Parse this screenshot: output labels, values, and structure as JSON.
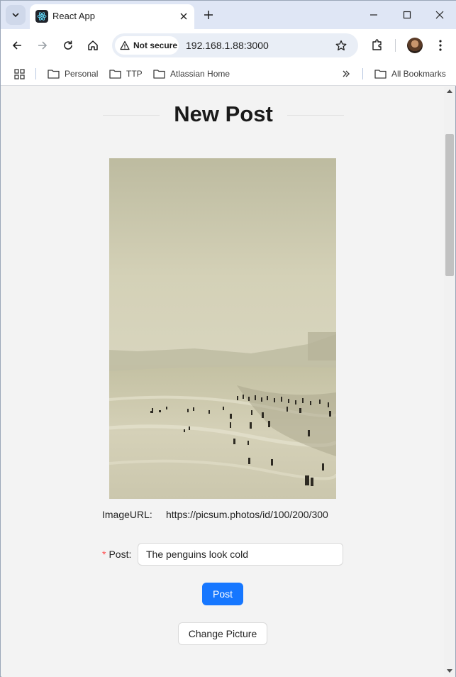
{
  "browser": {
    "tab_title": "React App",
    "security_label": "Not secure",
    "address": "192.168.1.88:3000",
    "bookmarks": {
      "items": [
        {
          "label": "Personal",
          "icon": "folder-icon"
        },
        {
          "label": "TTP",
          "icon": "folder-icon"
        },
        {
          "label": "Atlassian Home",
          "icon": "folder-icon"
        }
      ],
      "overflow_icon": "chevron-double-right-icon",
      "all_bookmarks_label": "All Bookmarks"
    }
  },
  "page": {
    "title": "New Post",
    "image_url_label": "ImageURL:",
    "image_url_value": "https://picsum.photos/id/100/200/300",
    "post_label": "Post:",
    "post_value": "The penguins look cold",
    "post_button": "Post",
    "change_picture_button": "Change Picture"
  },
  "colors": {
    "primary": "#1677ff",
    "required_mark": "#ff4d4f",
    "tabstrip": "#dfe6f5",
    "page_background": "#f3f3f3"
  }
}
